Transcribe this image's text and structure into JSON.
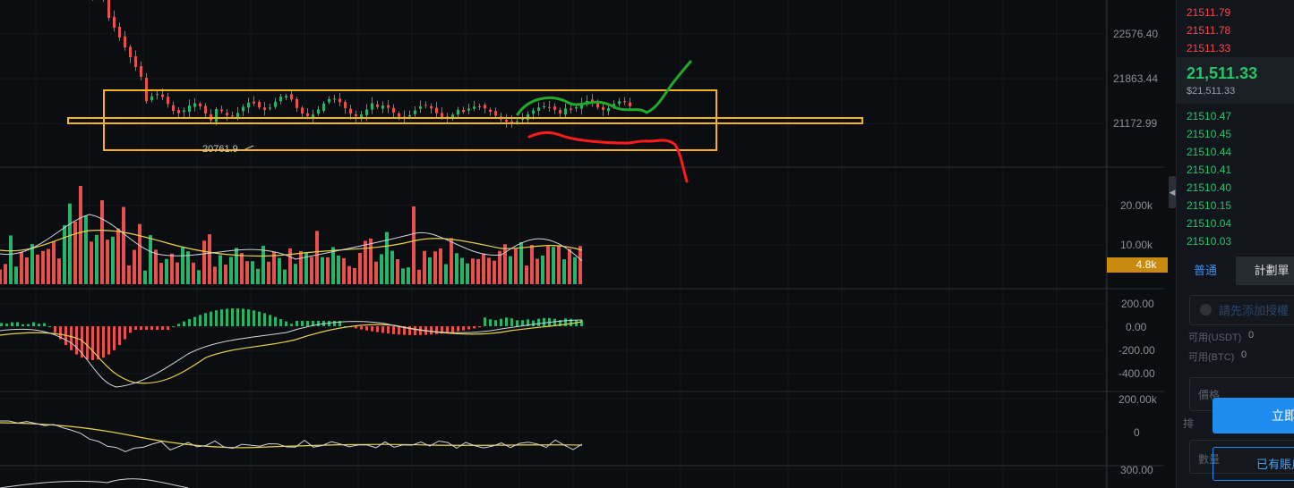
{
  "chart": {
    "price_axis": [
      "22576.40",
      "21863.44",
      "21172.99"
    ],
    "volume_axis": [
      "20.00k",
      "10.00k"
    ],
    "volume_badge": "4.8k",
    "macd_axis": [
      "200.00",
      "0.00",
      "-200.00",
      "-400.00"
    ],
    "osc_axis": [
      "200.00k",
      "0",
      "300.00"
    ],
    "low_annotation": "20761.9",
    "colors": {
      "background": "#0b0d10",
      "up": "#26b46a",
      "down": "#e8504f",
      "ma_yellow": "#e6d24a",
      "ma_white": "#cfd3da",
      "highlight_box": "#f5b31c",
      "bull_path": "#1faa2a",
      "bear_path": "#ff1a1a",
      "badge": "#c98a10"
    }
  },
  "orderbook": {
    "asks": [
      "21511.79",
      "21511.78",
      "21511.33"
    ],
    "last_price": "21,511.33",
    "last_price_usd": "$21,511.33",
    "bids": [
      "21510.47",
      "21510.45",
      "21510.44",
      "21510.41",
      "21510.40",
      "21510.15",
      "21510.04",
      "21510.03"
    ]
  },
  "trade_panel": {
    "tabs": [
      "普通",
      "計劃單"
    ],
    "hint": "請先添加授權",
    "available_usdt_label": "可用(USDT)",
    "available_usdt_value": "0",
    "available_btc_label": "可用(BTC)",
    "available_btc_value": "0",
    "price_label": "價格",
    "side_label": "排",
    "amount_label": "數量",
    "primary_button": "立即",
    "secondary_button": "已有賬戶"
  }
}
